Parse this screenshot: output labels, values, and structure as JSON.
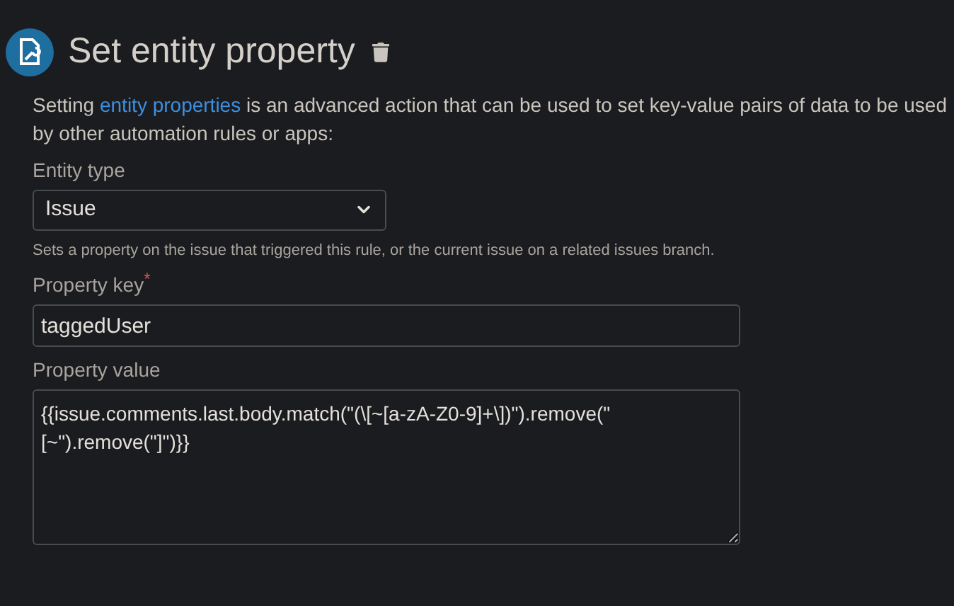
{
  "header": {
    "title": "Set entity property"
  },
  "description": {
    "before": "Setting ",
    "link": "entity properties",
    "after": " is an advanced action that can be used to set key-value pairs of data to be used by other automation rules or apps:"
  },
  "fields": [
    {
      "kind": "select",
      "label": "Entity type",
      "value": "Issue",
      "help": "Sets a property on the issue that triggered this rule, or the current issue on a related issues branch."
    },
    {
      "kind": "input",
      "label": "Property key",
      "required_mark": "*",
      "value": "taggedUser"
    },
    {
      "kind": "textarea",
      "label": "Property value",
      "value": "{{issue.comments.last.body.match(\"(\\[~[a-zA-Z0-9]+\\])\").remove(\"[~\").remove(\"]\")}}"
    }
  ]
}
